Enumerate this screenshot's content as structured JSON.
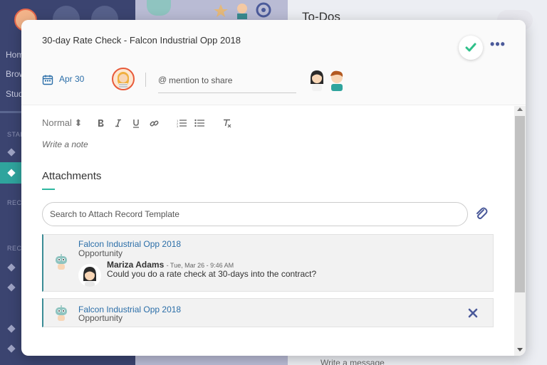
{
  "background": {
    "title": "To-Dos",
    "nav": [
      "Hom",
      "Brow",
      "Stud"
    ],
    "sections": [
      "STAR",
      "RECE",
      "RECE"
    ],
    "message_placeholder": "Write a message"
  },
  "modal": {
    "title": "30-day Rate Check - Falcon Industrial Opp 2018",
    "more_label": "•••",
    "due_date": "Apr 30",
    "mention_at": "@",
    "mention_placeholder": "mention to share"
  },
  "editor": {
    "format_select": "Normal ⬍",
    "note_placeholder": "Write a note"
  },
  "attachments": {
    "title": "Attachments",
    "search_placeholder": "Search to Attach Record Template",
    "cards": [
      {
        "record_name": "Falcon Industrial Opp 2018",
        "record_type": "Opportunity",
        "comment": {
          "author": "Mariza Adams",
          "time": "- Tue, Mar 26 - 9:46 AM",
          "text": "Could you do a rate check at 30-days into the contract?"
        }
      },
      {
        "record_name": "Falcon Industrial Opp 2018",
        "record_type": "Opportunity"
      }
    ]
  },
  "colors": {
    "accent": "#2fb8a0",
    "link": "#2b6ea8",
    "check": "#2fc08a",
    "icon": "#4b5a9a"
  }
}
